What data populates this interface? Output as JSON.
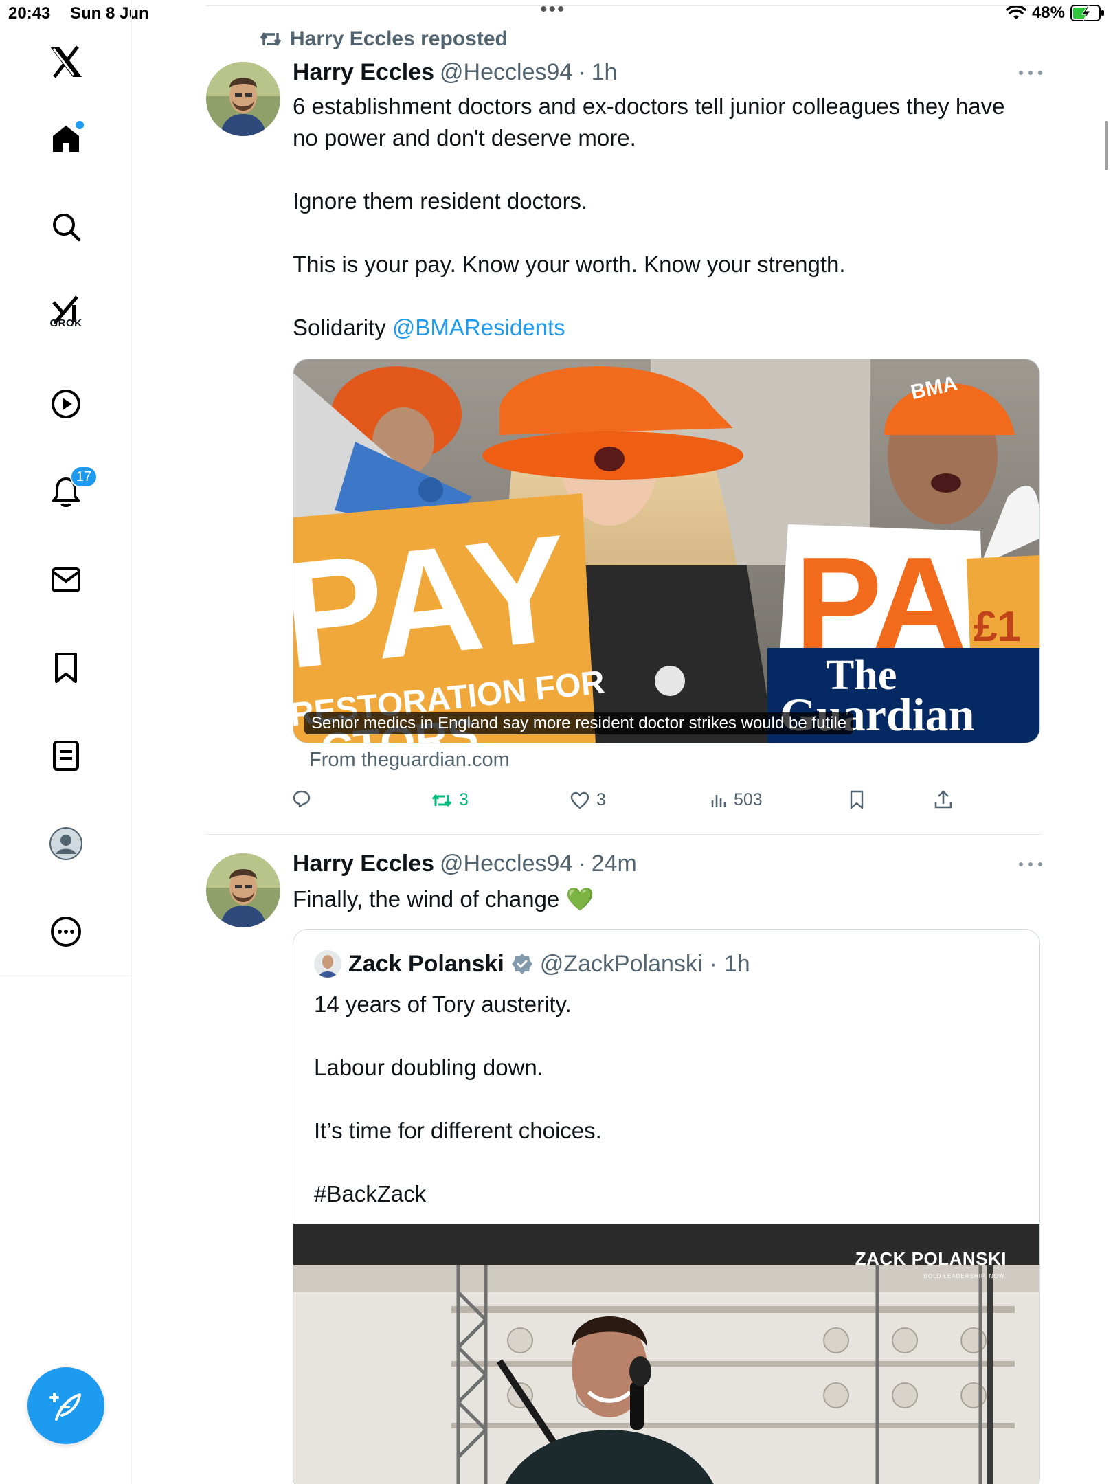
{
  "status_bar": {
    "time": "20:43",
    "date": "Sun 8 Jun",
    "battery": "48%"
  },
  "sidebar": {
    "items": [
      {
        "name": "x-logo"
      },
      {
        "name": "home",
        "has_dot": true
      },
      {
        "name": "explore"
      },
      {
        "name": "grok",
        "label": "GROK"
      },
      {
        "name": "videos"
      },
      {
        "name": "notifications",
        "badge": "17"
      },
      {
        "name": "messages"
      },
      {
        "name": "bookmarks"
      },
      {
        "name": "lists"
      },
      {
        "name": "profile"
      },
      {
        "name": "more"
      }
    ]
  },
  "feed": {
    "tweet1": {
      "repost_label": "Harry Eccles reposted",
      "author_name": "Harry Eccles",
      "handle": "@Heccles94",
      "dot": "·",
      "time": "1h",
      "body": [
        "6 establishment doctors and ex-doctors tell junior colleagues they have",
        "no power and don't deserve more.",
        "Ignore them resident doctors.",
        "This is your pay. Know your worth. Know your strength."
      ],
      "solidarity_text": "Solidarity ",
      "mention": "@BMAResidents",
      "media_caption": "Senior medics in England say more resident doctor strikes would be futile",
      "media_text": {
        "sign_left": "PAY",
        "sign_left_sub": "RESTORATION FOR",
        "sign_left_sub2": "CTORS",
        "sign_right": "PA",
        "sign_price": "£1",
        "bma_hat": "BMA",
        "guardian_1": "The",
        "guardian_2": "Guardian"
      },
      "source": "From theguardian.com",
      "actions": {
        "retweets": "3",
        "likes": "3",
        "views": "503"
      }
    },
    "tweet2": {
      "author_name": "Harry Eccles",
      "handle": "@Heccles94",
      "dot": "·",
      "time": "24m",
      "body": "Finally, the wind of change 💚",
      "quote": {
        "author_name": "Zack Polanski",
        "handle": "@ZackPolanski",
        "dot": "·",
        "time": "1h",
        "body": [
          "14 years of Tory austerity.",
          "Labour doubling down.",
          "It’s time for different choices.",
          "#BackZack"
        ],
        "watermark": "ZACK POLANSKI",
        "watermark_sub": "BOLD LEADERSHIP. NOW."
      }
    }
  },
  "colors": {
    "accent": "#1d9bf0",
    "retweet": "#00ba7c",
    "muted": "#536471",
    "guardian_blue": "#052962",
    "orange": "#f26a1b"
  }
}
